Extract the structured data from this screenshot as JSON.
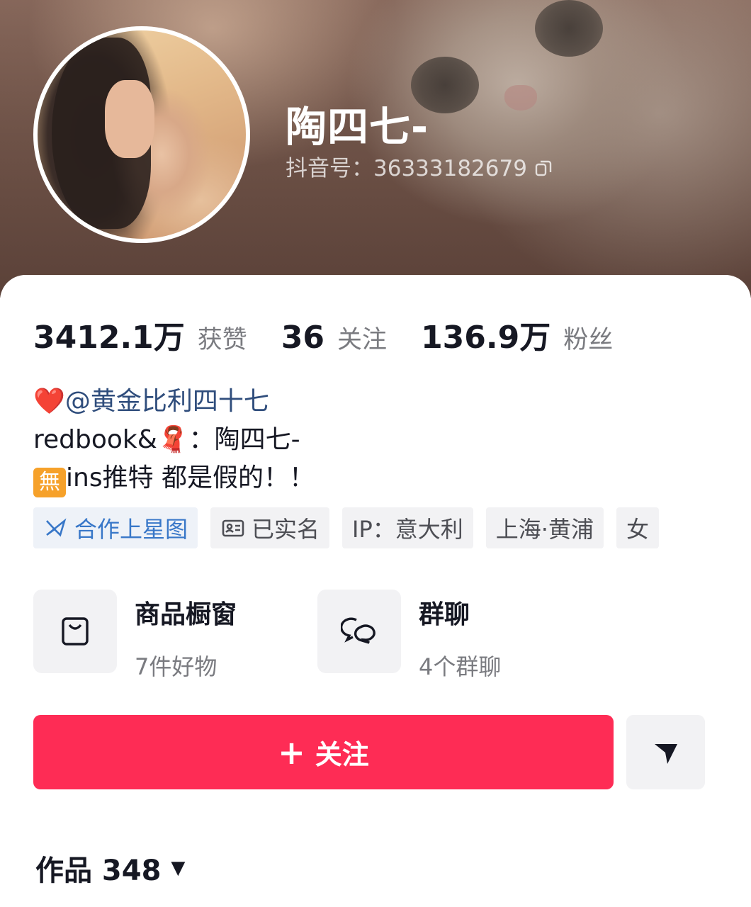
{
  "profile": {
    "username": "陶四七-",
    "douyin_id": "抖音号：36333182679"
  },
  "stats": [
    {
      "value": "3412.1万",
      "label": "获赞"
    },
    {
      "value": "36",
      "label": "关注"
    },
    {
      "value": "136.9万",
      "label": "粉丝"
    }
  ],
  "bio": {
    "line1_heart": "❤️",
    "line1_mention": "@黄金比利四十七",
    "line2_prefix": "redbook&",
    "line2_scarf": "🧣",
    "line2_suffix": "：陶四七-",
    "line3_badge": "無",
    "line3_text": "ins推特 都是假的！！"
  },
  "tags": {
    "star": "合作上星图",
    "verified": "已实名",
    "ip": "IP：意大利",
    "location": "上海·黄浦",
    "gender": "女"
  },
  "features": {
    "shop_title": "商品橱窗",
    "shop_sub": "7件好物",
    "group_title": "群聊",
    "group_sub": "4个群聊"
  },
  "actions": {
    "follow_plus": "+",
    "follow_label": "关注"
  },
  "works": {
    "label": "作品 348",
    "caret": "▼"
  },
  "colors": {
    "accent": "#fe2c55",
    "mention": "#2f4d7c",
    "star_tag": "#3877c8"
  }
}
